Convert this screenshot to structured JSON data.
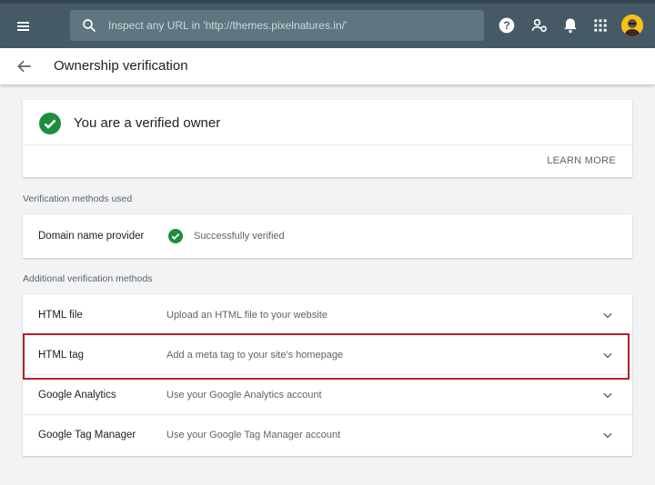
{
  "topbar": {
    "search_placeholder": "Inspect any URL in 'http://themes.pixelnatures.in/'",
    "icons": [
      "menu-icon",
      "search-icon",
      "help-icon",
      "manage-users-icon",
      "notifications-icon",
      "apps-icon",
      "avatar"
    ]
  },
  "header": {
    "title": "Ownership verification"
  },
  "owner": {
    "title": "You are a verified owner",
    "learn_more": "LEARN MORE"
  },
  "used": {
    "label": "Verification methods used",
    "method": "Domain name provider",
    "status": "Successfully verified"
  },
  "additional": {
    "label": "Additional verification methods",
    "items": [
      {
        "name": "HTML file",
        "desc": "Upload an HTML file to your website"
      },
      {
        "name": "HTML tag",
        "desc": "Add a meta tag to your site's homepage"
      },
      {
        "name": "Google Analytics",
        "desc": "Use your Google Analytics account"
      },
      {
        "name": "Google Tag Manager",
        "desc": "Use your Google Tag Manager account"
      }
    ]
  },
  "colors": {
    "topbar": "#455a64",
    "success_green": "#1e8e3e",
    "highlight_red": "#b3222b"
  }
}
